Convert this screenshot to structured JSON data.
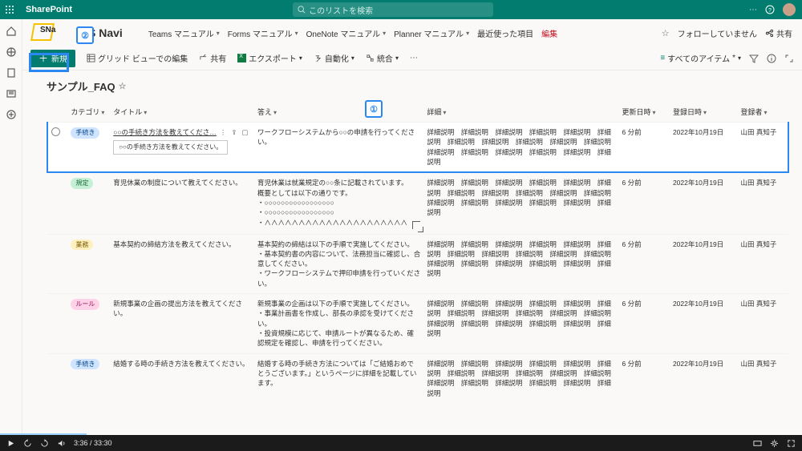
{
  "suite": {
    "app": "SharePoint",
    "search_placeholder": "このリストを検索"
  },
  "site": {
    "logo_text": "SNa",
    "title": "S Navi",
    "nav": [
      {
        "label": "Teams マニュアル"
      },
      {
        "label": "Forms マニュアル"
      },
      {
        "label": "OneNote マニュアル"
      },
      {
        "label": "Planner マニュアル"
      },
      {
        "label": "最近使った項目"
      }
    ],
    "edit": "編集",
    "follow": "フォローしていません",
    "share": "共有"
  },
  "cmd": {
    "new": "新規",
    "gridview": "グリッド ビューでの編集",
    "share": "共有",
    "export": "エクスポート",
    "automate": "自動化",
    "integrate": "統合",
    "view": "すべてのアイテム"
  },
  "list": {
    "title": "サンプル_FAQ",
    "cols": {
      "category": "カテゴリ",
      "title": "タイトル",
      "answer": "答え",
      "detail": "詳細",
      "updated": "更新日時",
      "regdate": "登録日時",
      "author": "登録者"
    },
    "rows": [
      {
        "cat": "手続き",
        "cat_c": "blue",
        "title": "○○の手続き方法を教えてくださ…",
        "tooltip": "○○の手続き方法を教えてください。",
        "answer": "ワークフローシステムから○○の申請を行ってください。",
        "detail": "詳細説明　詳細説明　詳細説明　詳細説明　詳細説明　詳細説明　詳細説明　詳細説明　詳細説明　詳細説明　詳細説明　詳細説明　詳細説明　詳細説明　詳細説明　詳細説明　詳細説明",
        "updated": "6 分前",
        "regdate": "2022年10月19日",
        "author": "山田 真知子"
      },
      {
        "cat": "規定",
        "cat_c": "green",
        "title": "育児休業の制度について教えてください。",
        "answer": "育児休業は就業規定の○○条に記載されています。\n概要としては以下の通りです。\n・○○○○○○○○○○○○○○○○○\n・○○○○○○○○○○○○○○○○○\n・∧∧∧∧∧∧∧∧∧∧∧∧∧∧∧∧∧∧∧∧∧",
        "detail": "詳細説明　詳細説明　詳細説明　詳細説明　詳細説明　詳細説明　詳細説明　詳細説明　詳細説明　詳細説明　詳細説明　詳細説明　詳細説明　詳細説明　詳細説明　詳細説明　詳細説明",
        "updated": "6 分前",
        "regdate": "2022年10月19日",
        "author": "山田 真知子"
      },
      {
        "cat": "業務",
        "cat_c": "yellow",
        "title": "基本契約の締結方法を教えてください。",
        "answer": "基本契約の締結は以下の手順で実施してください。\n・基本契約書の内容について、法務担当に確認し、合意してください。\n・ワークフローシステムで押印申請を行っていください。",
        "detail": "詳細説明　詳細説明　詳細説明　詳細説明　詳細説明　詳細説明　詳細説明　詳細説明　詳細説明　詳細説明　詳細説明　詳細説明　詳細説明　詳細説明　詳細説明　詳細説明　詳細説明",
        "updated": "6 分前",
        "regdate": "2022年10月19日",
        "author": "山田 真知子"
      },
      {
        "cat": "ルール",
        "cat_c": "pink",
        "title": "新規事業の企画の提出方法を教えてください。",
        "answer": "新規事業の企画は以下の手順で実施してください。\n・事業計画書を作成し、部長の承認を受けてください。\n・投資規模に応じて、申請ルートが異なるため、確認規定を確認し、申請を行ってください。",
        "detail": "詳細説明　詳細説明　詳細説明　詳細説明　詳細説明　詳細説明　詳細説明　詳細説明　詳細説明　詳細説明　詳細説明　詳細説明　詳細説明　詳細説明　詳細説明　詳細説明　詳細説明",
        "updated": "6 分前",
        "regdate": "2022年10月19日",
        "author": "山田 真知子"
      },
      {
        "cat": "手続き",
        "cat_c": "blue",
        "title": "結婚する時の手続き方法を教えてください。",
        "answer": "結婚する時の手続き方法については「ご結婚おめでとうございます。」というページに詳細を記載しています。",
        "detail": "詳細説明　詳細説明　詳細説明　詳細説明　詳細説明　詳細説明　詳細説明　詳細説明　詳細説明　詳細説明　詳細説明　詳細説明　詳細説明　詳細説明　詳細説明　詳細説明　詳細説明",
        "updated": "6 分前",
        "regdate": "2022年10月19日",
        "author": "山田 真知子"
      }
    ]
  },
  "callouts": {
    "c1": "①",
    "c2": "②"
  },
  "video": {
    "time": "3:36 / 33:30"
  }
}
